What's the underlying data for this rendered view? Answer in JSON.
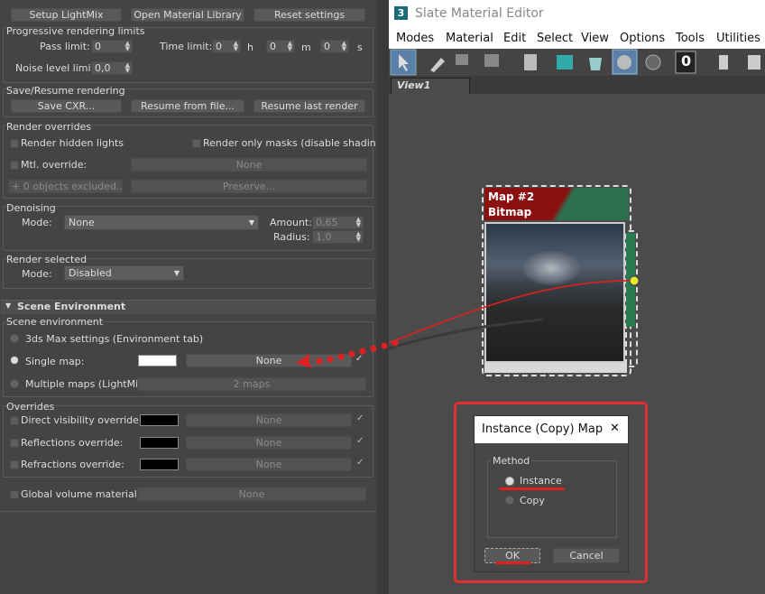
{
  "top_buttons": [
    "Setup LightMix",
    "Open Material Library",
    "Reset settings"
  ],
  "progressive": {
    "title": "Progressive rendering limits",
    "pass_label": "Pass limit:",
    "pass_value": "0",
    "time_label": "Time limit:",
    "h_value": "0",
    "h_unit": "h",
    "m_value": "0",
    "m_unit": "m",
    "s_value": "0",
    "s_unit": "s",
    "noise_label": "Noise level limit:",
    "noise_value": "0,0"
  },
  "save_resume": {
    "title": "Save/Resume rendering",
    "buttons": [
      "Save CXR...",
      "Resume from file...",
      "Resume last render"
    ]
  },
  "overrides_render": {
    "title": "Render overrides",
    "hidden_lights": "Render hidden lights",
    "only_masks": "Render only masks (disable shading)",
    "mtl_override": "Mtl. override:",
    "mtl_value": "None",
    "excluded": "0 objects excluded...",
    "plus": "+",
    "preserve": "Preserve..."
  },
  "denoising": {
    "title": "Denoising",
    "mode_label": "Mode:",
    "mode_value": "None",
    "amount_label": "Amount:",
    "amount_value": "0,65",
    "radius_label": "Radius:",
    "radius_value": "1,0"
  },
  "render_selected": {
    "title": "Render selected",
    "mode_label": "Mode:",
    "mode_value": "Disabled"
  },
  "scene_env": {
    "rollout_title": "Scene Environment",
    "arrow": "▼",
    "group_title": "Scene environment",
    "opt1": "3ds Max settings (Environment tab)",
    "opt2": "Single map:",
    "opt2_value": "None",
    "opt3": "Multiple maps (LightMix):",
    "opt3_value": "2 maps",
    "swatch_color": "#ffffff"
  },
  "overrides2": {
    "title": "Overrides",
    "items": [
      {
        "label": "Direct visibility override:",
        "value": "None"
      },
      {
        "label": "Reflections override:",
        "value": "None"
      },
      {
        "label": "Refractions override:",
        "value": "None"
      }
    ],
    "check": "✓"
  },
  "global_volume": {
    "label": "Global volume material:",
    "value": "None"
  },
  "editor": {
    "app_icon": "3",
    "title": "Slate Material Editor",
    "menus": [
      "Modes",
      "Material",
      "Edit",
      "Select",
      "View",
      "Options",
      "Tools",
      "Utilities"
    ],
    "tab": "View1",
    "toolbar_zero": "0"
  },
  "node": {
    "title1": "Map #2",
    "title2": "Bitmap"
  },
  "dialog": {
    "title": "Instance (Copy) Map",
    "close": "✕",
    "method": "Method",
    "instance": "Instance",
    "copy": "Copy",
    "ok": "OK",
    "cancel": "Cancel"
  }
}
